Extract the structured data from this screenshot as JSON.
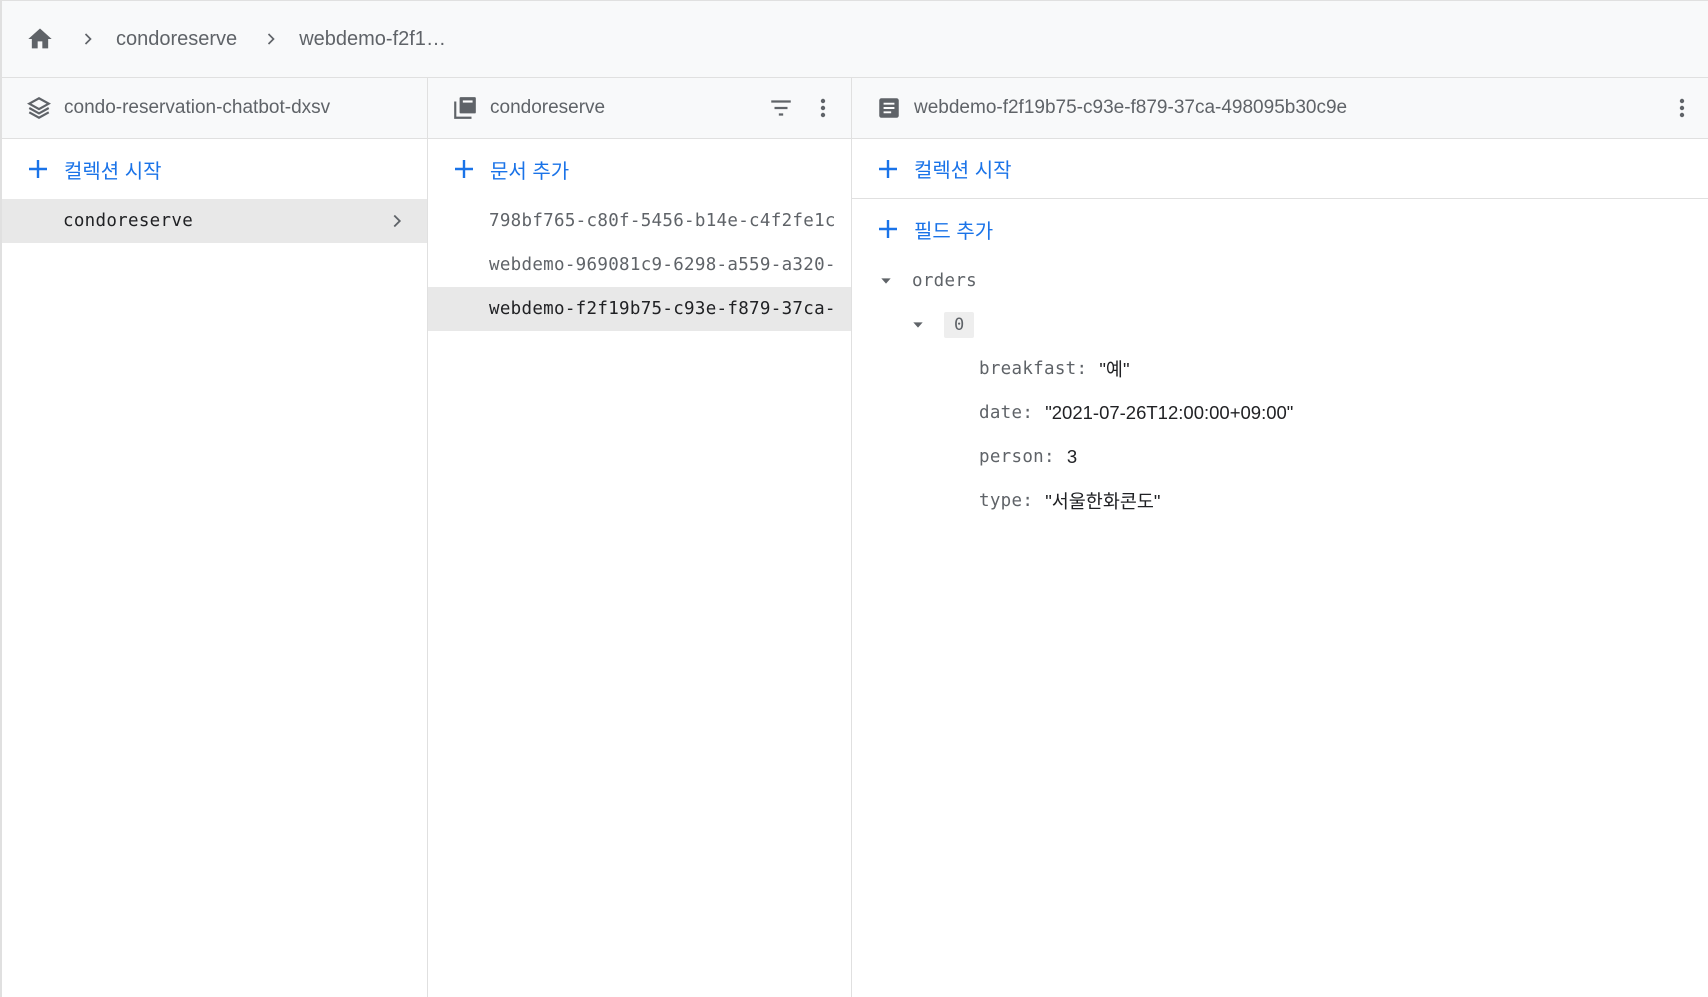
{
  "breadcrumb": {
    "home_icon": "home-icon",
    "items": [
      "condoreserve",
      "webdemo-f2f19…"
    ]
  },
  "columns": {
    "project": {
      "title": "condo-reservation-chatbot-dxsv",
      "icon": "project-stack-icon",
      "add_label": "컬렉션 시작",
      "items": [
        "condoreserve"
      ]
    },
    "collection": {
      "title": "condoreserve",
      "icon": "collection-icon",
      "add_label": "문서 추가",
      "items": [
        "798bf765-c80f-5456-b14e-c4f2fe1c",
        "webdemo-969081c9-6298-a559-a320-",
        "webdemo-f2f19b75-c93e-f879-37ca-"
      ],
      "selected_index": 2
    },
    "document": {
      "title": "webdemo-f2f19b75-c93e-f879-37ca-498095b30c9e",
      "icon": "document-icon",
      "add_collection_label": "컬렉션 시작",
      "add_field_label": "필드 추가",
      "fields": {
        "root_key": "orders",
        "index": "0",
        "entries": [
          {
            "key": "breakfast:",
            "value": "\"예\""
          },
          {
            "key": "date:",
            "value": "\"2021-07-26T12:00:00+09:00\""
          },
          {
            "key": "person:",
            "value": "3"
          },
          {
            "key": "type:",
            "value": "\"서울한화콘도\""
          }
        ]
      }
    }
  },
  "colors": {
    "accent": "#1a73e8",
    "header_bg": "#f8f9fa",
    "selected_bg": "#e8e8e8",
    "border": "#e0e0e0"
  }
}
